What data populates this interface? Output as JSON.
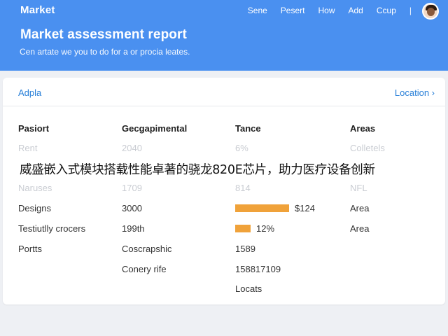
{
  "header": {
    "brand": "Market",
    "nav": [
      "Sene",
      "Pesert",
      "How",
      "Add",
      "Ccup"
    ],
    "separator": "|",
    "title": "Market assessment report",
    "subtitle": "Cen artate we you to do for a or procia leates."
  },
  "card": {
    "tab_label": "Adpla",
    "link_label": "Location ›"
  },
  "table": {
    "headers": [
      "Pasiort",
      "Gecgapimental",
      "Tance",
      "Areas"
    ],
    "rows": [
      [
        "Rent",
        "2040",
        "6%",
        "Colletels"
      ],
      [
        "",
        "",
        "",
        ""
      ],
      [
        "Naruses",
        "1709",
        "814",
        "NFL"
      ],
      [
        "Designs",
        "3000",
        "$124",
        "Area"
      ],
      [
        "Testiutlly crocers",
        "199th",
        "12%",
        "Area"
      ],
      [
        "Portts",
        "Coscrapshic",
        "1589",
        ""
      ],
      [
        "",
        "Conery rife",
        "158817109",
        ""
      ],
      [
        "",
        "",
        "Locats",
        ""
      ]
    ],
    "progress": {
      "designs": 0.86,
      "testiutlly": 0.24
    }
  },
  "overlay_text": "威盛嵌入式模块搭载性能卓著的骁龙820E芯片，助力医疗设备创新",
  "colors": {
    "header_bg": "#4a90f0",
    "link": "#2a80d8",
    "bar": "#f0a23a"
  }
}
